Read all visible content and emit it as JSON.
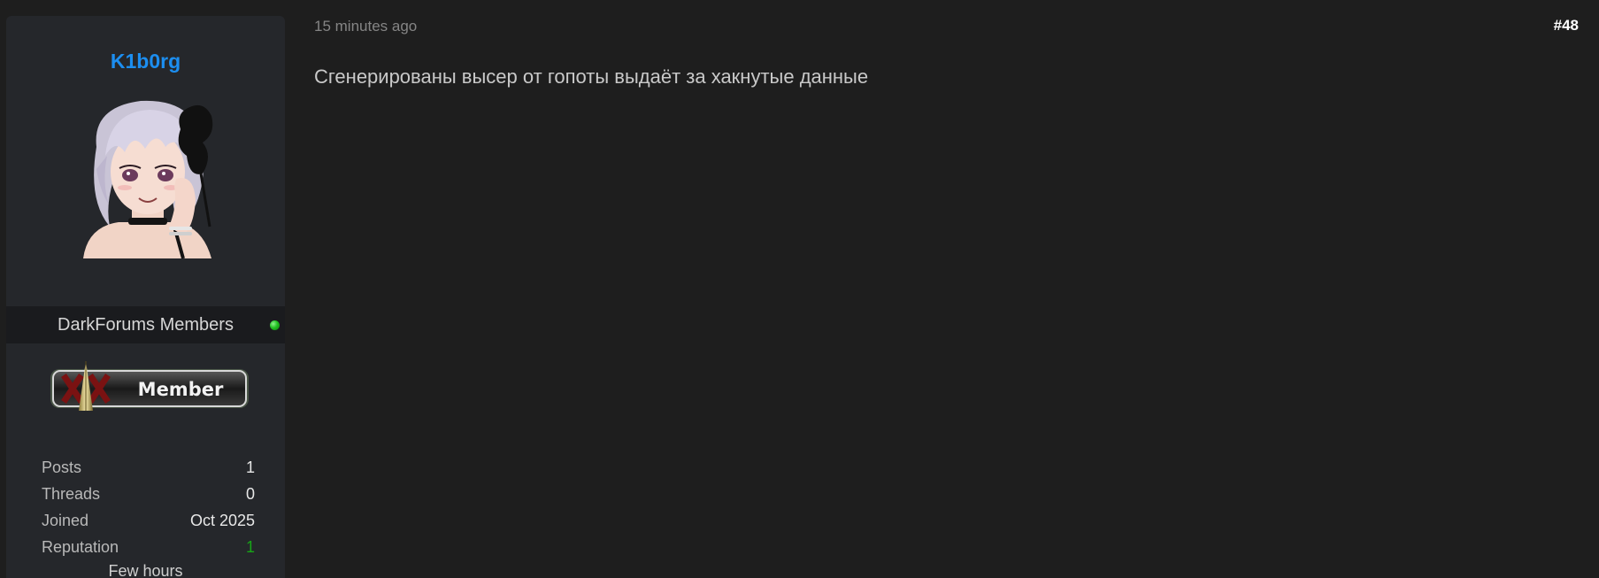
{
  "author": {
    "username": "K1b0rg",
    "usergroup": "DarkForums Members",
    "online": true,
    "rank": "Member",
    "stats": [
      {
        "label": "Posts",
        "value": "1"
      },
      {
        "label": "Threads",
        "value": "0"
      },
      {
        "label": "Joined",
        "value": "Oct 2025"
      },
      {
        "label": "Reputation",
        "value": "1"
      }
    ],
    "last_seen": "Few hours"
  },
  "post": {
    "time": "15 minutes ago",
    "number": "#48",
    "body": "Сгенерированы высер от гопоты выдаёт за хакнутые данные"
  },
  "colors": {
    "username": "#1c8ef0",
    "online": "#22c122",
    "reputation_positive": "#17a517",
    "background": "#1e1e1e",
    "panel": "#25272b"
  }
}
